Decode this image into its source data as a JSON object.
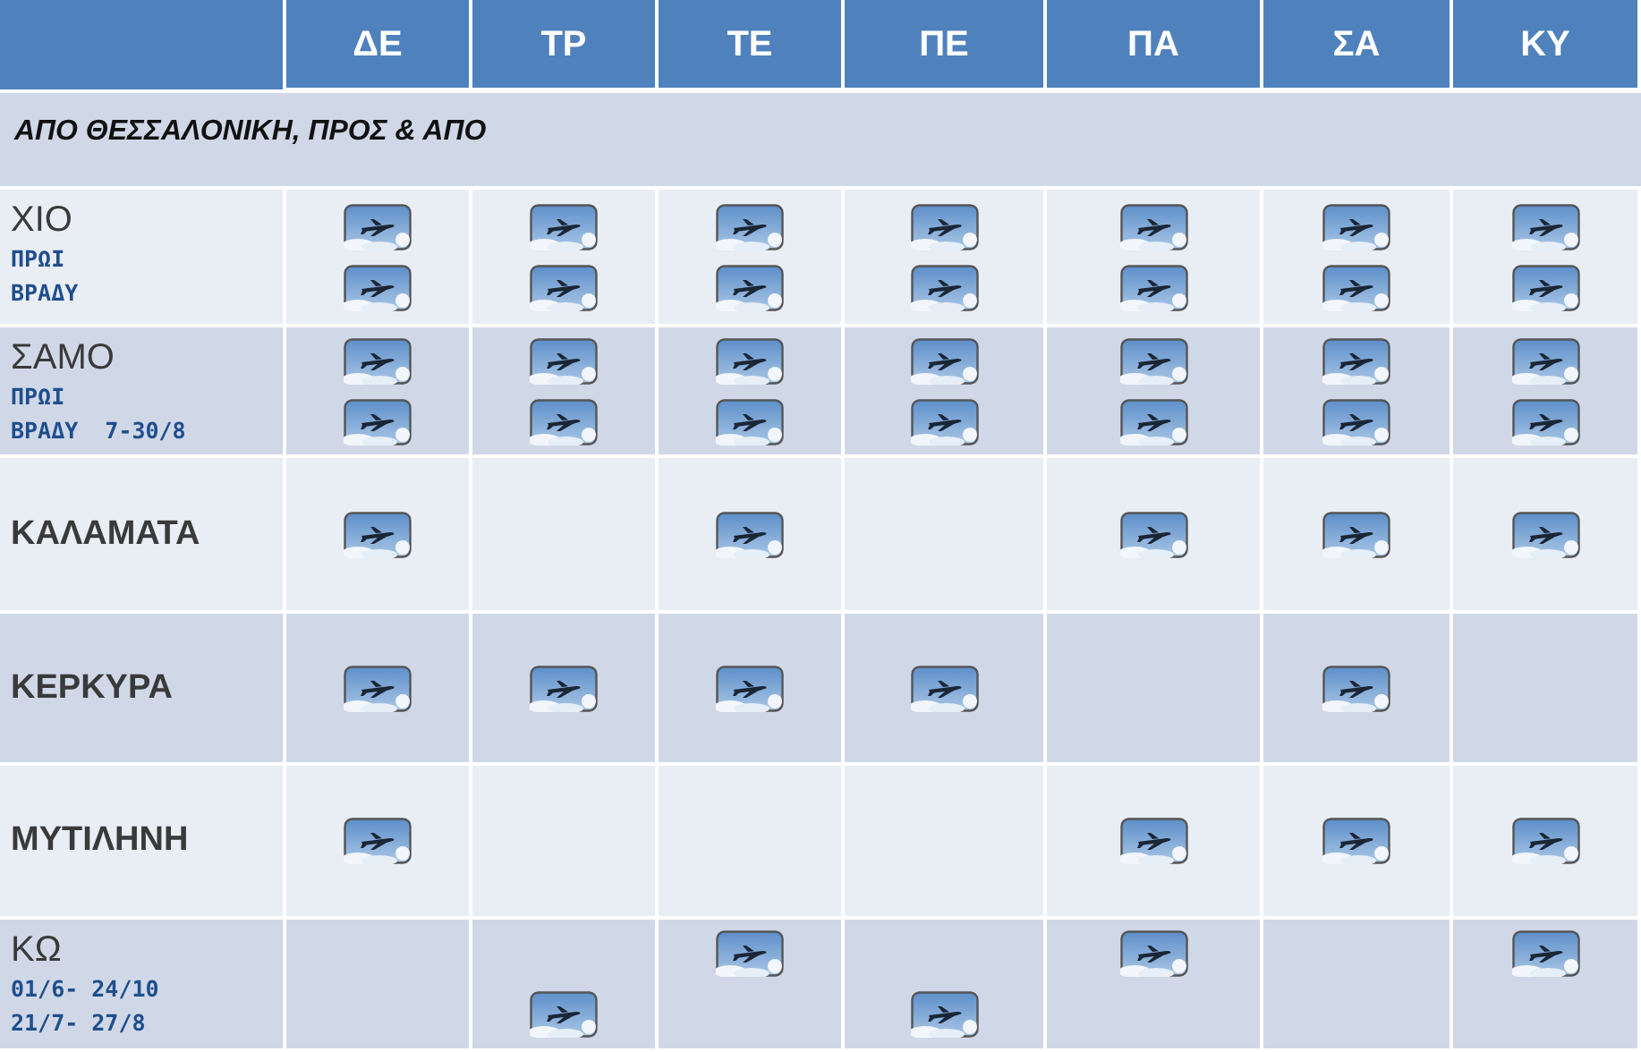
{
  "days": [
    {
      "label": "ΔΕ"
    },
    {
      "label": "ΤΡ"
    },
    {
      "label": "ΤΕ"
    },
    {
      "label": "ΠΕ"
    },
    {
      "label": "ΠΑ"
    },
    {
      "label": "ΣΑ"
    },
    {
      "label": "ΚΥ"
    }
  ],
  "section": "ΑΠΟ ΘΕΣΣΑΛΟΝΙΚΗ, ΠΡΟΣ & ΑΠΟ",
  "routes": [
    {
      "name": "ΧΙΟ",
      "notes": [
        "ΠΡΩΙ",
        "ΒΡΑΔΥ"
      ],
      "days": [
        [
          true,
          true
        ],
        [
          true,
          true
        ],
        [
          true,
          true
        ],
        [
          true,
          true
        ],
        [
          true,
          true
        ],
        [
          true,
          true
        ],
        [
          true,
          true
        ]
      ]
    },
    {
      "name": "ΣΑΜΟ",
      "notes": [
        "ΠΡΩΙ",
        "ΒΡΑΔΥ  7-30/8"
      ],
      "days": [
        [
          true,
          true
        ],
        [
          true,
          true
        ],
        [
          true,
          true
        ],
        [
          true,
          true
        ],
        [
          true,
          true
        ],
        [
          true,
          true
        ],
        [
          true,
          true
        ]
      ]
    },
    {
      "name": "ΚΑΛΑΜΑΤΑ",
      "days": [
        [
          true
        ],
        [
          false
        ],
        [
          true
        ],
        [
          false
        ],
        [
          true
        ],
        [
          true
        ],
        [
          true
        ]
      ]
    },
    {
      "name": "ΚΕΡΚΥΡΑ",
      "days": [
        [
          true
        ],
        [
          true
        ],
        [
          true
        ],
        [
          true
        ],
        [
          false
        ],
        [
          true
        ],
        [
          false
        ]
      ]
    },
    {
      "name": "ΜΥΤΙΛΗΝΗ",
      "days": [
        [
          true
        ],
        [
          false
        ],
        [
          false
        ],
        [
          false
        ],
        [
          true
        ],
        [
          true
        ],
        [
          true
        ]
      ]
    },
    {
      "name": "ΚΩ",
      "notes": [
        "01/6- 24/10",
        "21/7- 27/8"
      ],
      "days": [
        [
          false,
          false
        ],
        [
          false,
          true
        ],
        [
          true,
          false
        ],
        [
          false,
          true
        ],
        [
          true,
          false
        ],
        [
          false,
          false
        ],
        [
          true,
          false
        ]
      ]
    }
  ]
}
